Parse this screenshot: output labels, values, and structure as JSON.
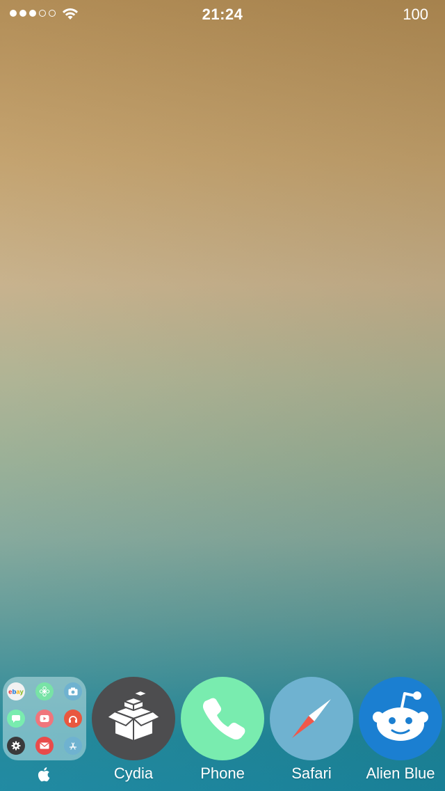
{
  "status_bar": {
    "signal_dots": [
      true,
      true,
      true,
      false,
      false
    ],
    "time": "21:24",
    "battery": "100"
  },
  "wallpaper": {
    "colors": [
      "#b08a52",
      "#c6b08a",
      "#98ae94",
      "#5f9a98",
      "#1a87a0"
    ]
  },
  "dock": {
    "folder": {
      "label_icon": "apple-logo-icon",
      "mini_apps": [
        {
          "name": "ebay",
          "text": "ebay",
          "color": "#f2f2f2"
        },
        {
          "name": "flower",
          "text": "",
          "color": "#78e3a6"
        },
        {
          "name": "camera",
          "text": "",
          "color": "#6fb2d0"
        },
        {
          "name": "messages",
          "text": "",
          "color": "#79ecaf"
        },
        {
          "name": "youtube",
          "text": "",
          "color": "#f0757c"
        },
        {
          "name": "music",
          "text": "",
          "color": "#e9573f"
        },
        {
          "name": "settings",
          "text": "",
          "color": "#3a3a3c"
        },
        {
          "name": "mail",
          "text": "",
          "color": "#e94b4b"
        },
        {
          "name": "app-store",
          "text": "",
          "color": "#6fb2d0"
        }
      ]
    },
    "apps": [
      {
        "name": "cydia",
        "label": "Cydia",
        "icon": "cydia-box-icon",
        "color": "#4d4d4f"
      },
      {
        "name": "phone",
        "label": "Phone",
        "icon": "phone-handset-icon",
        "color": "#79ecaf"
      },
      {
        "name": "safari",
        "label": "Safari",
        "icon": "compass-icon",
        "color": "#6fb2d0"
      },
      {
        "name": "alien-blue",
        "label": "Alien Blue",
        "icon": "reddit-alien-icon",
        "color": "#1b7fd1"
      }
    ]
  }
}
